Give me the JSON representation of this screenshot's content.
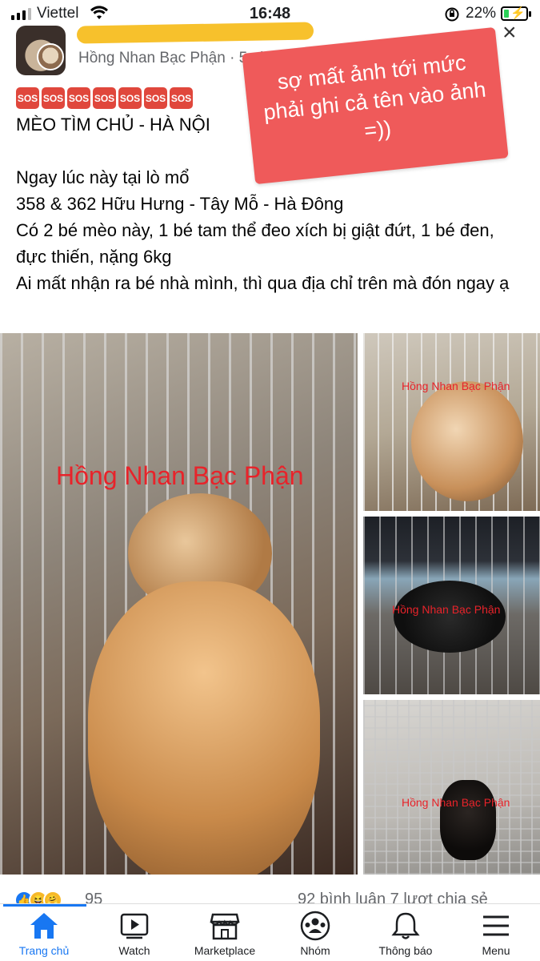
{
  "status_bar": {
    "carrier": "Viettel",
    "time": "16:48",
    "battery": "22%",
    "battery_level": 0.22
  },
  "post": {
    "author": "Hồng Nhan Bạc Phận",
    "meta": " · 5 giờ",
    "sos_labels": [
      "SOS",
      "SOS",
      "SOS",
      "SOS",
      "SOS",
      "SOS",
      "SOS"
    ],
    "lines": [
      "MÈO TÌM CHỦ - HÀ NỘI",
      "",
      "Ngay lúc này tại lò mổ",
      "358 & 362 Hữu Hưng - Tây Mỗ - Hà Đông",
      "Có 2 bé mèo này, 1 bé tam thể đeo xích bị giật đứt, 1 bé đen, đực thiến, nặng 6kg",
      "Ai mất nhận ra bé nhà mình, thì qua địa chỉ trên mà đón ngay ạ"
    ],
    "watermark": "Hồng Nhan Bạc Phận",
    "annotation": "sợ mất ảnh tới mức phải ghi cả tên vào ảnh =))",
    "reaction_count": "95",
    "comments_shares": "92 bình luận  7 lượt chia sẻ"
  },
  "tabbar": {
    "items": [
      {
        "label": "Trang chủ",
        "icon": "home-icon",
        "active": true
      },
      {
        "label": "Watch",
        "icon": "watch-icon",
        "active": false
      },
      {
        "label": "Marketplace",
        "icon": "marketplace-icon",
        "active": false
      },
      {
        "label": "Nhóm",
        "icon": "groups-icon",
        "active": false
      },
      {
        "label": "Thông báo",
        "icon": "bell-icon",
        "active": false
      },
      {
        "label": "Menu",
        "icon": "menu-icon",
        "active": false
      }
    ]
  },
  "colors": {
    "accent": "#1877f2",
    "sticker": "#ef5a5a",
    "watermark": "#e8232a",
    "sos": "#e0473c"
  }
}
